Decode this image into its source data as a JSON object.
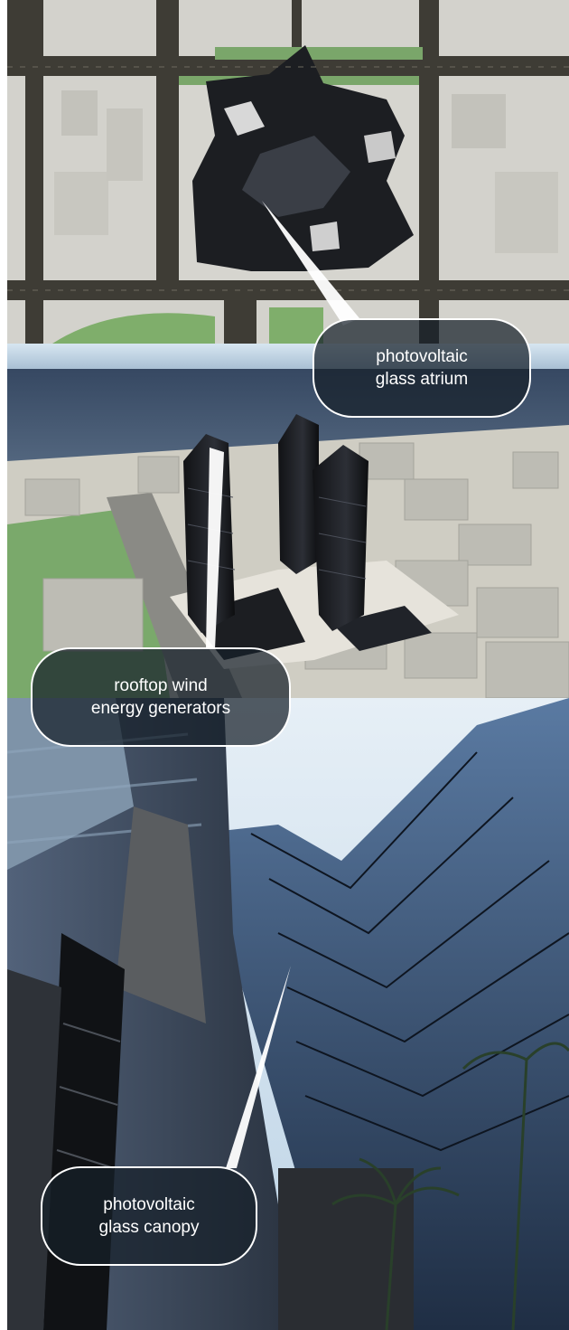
{
  "callouts": {
    "atrium": {
      "line1": "photovoltaic",
      "line2": "glass atrium"
    },
    "wind": {
      "line1": "rooftop wind",
      "line2": "energy generators"
    },
    "canopy": {
      "line1": "photovoltaic",
      "line2": "glass canopy"
    }
  },
  "colors": {
    "road": "#3e3c35",
    "block": "#d3d2cc",
    "building_dark": "#1c1e22",
    "sea": "#3f5068",
    "sky": "#c9dbea",
    "glass": "#2c3f58",
    "callout_fill": "#16202a",
    "callout_border": "#ffffff"
  }
}
